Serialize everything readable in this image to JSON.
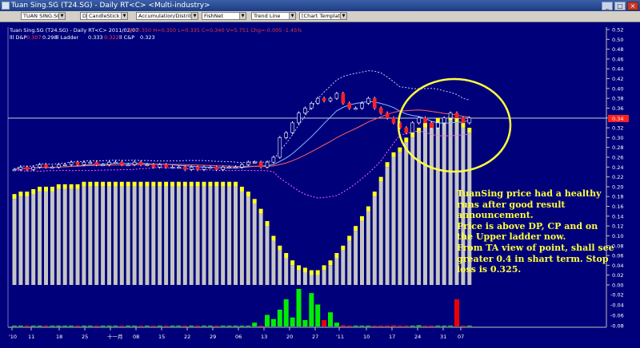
{
  "window": {
    "title": "Tuan Sing.SG (T24.SG) - Daily RT<C> <Multi-industry>",
    "buttons": [
      "_",
      "□",
      "×"
    ]
  },
  "toolbar": {
    "symbol": "TUAN SING.SG",
    "period": "Daily",
    "chart_style": "CandleStick",
    "indicator1": "Accumulation/Distribution",
    "indicator2": "FishNet",
    "indicator3": "Trend Line",
    "template": "[Chart Template]"
  },
  "header": {
    "line1": "Tuan Sing.SG (T24.SG) - Daily RT<C> 2011/02/07",
    "quote": "O=0.350  H=0.350  L=0.335  C=0.340  V=5,751  Chg=-0.005  -1.45%",
    "ind_label1": "lll D&P",
    "ind_val1a": "0.307",
    "ind_val1b": "0.298",
    "ind_label2": "ll Ladder",
    "ind_val2a": "0.333",
    "ind_val2b": "0.322",
    "ind_label3": "ll C&P",
    "ind_val3": "0.323"
  },
  "current_price_label": "0.34",
  "annotation": [
    "TuanSing price had a healthy",
    "runs after good result",
    "announcement.",
    "Price is above DP, CP and on",
    "the Upper ladder now.",
    "From TA view of point, shall see",
    "greater 0.4 in shart term. Stop",
    "loss is 0.325."
  ],
  "colors": {
    "background": "#00007a",
    "annotation": "#ffff3c",
    "highlight_circle": "#ffff3c",
    "ladder_upper": "#ffff22",
    "ladder_lower": "#c0c0c0",
    "volume_up": "#00ee00",
    "volume_down": "#ee0000"
  },
  "chart_data": {
    "type": "candlestick",
    "x_ticks": [
      "'10",
      "11",
      "18",
      "25",
      "十一月",
      "08",
      "15",
      "22",
      "29",
      "06",
      "13",
      "20",
      "27",
      "'11",
      "10",
      "17",
      "24",
      "31",
      "07"
    ],
    "y_ticks_price": [
      "0.52",
      "0.50",
      "0.48",
      "0.46",
      "0.44",
      "0.42",
      "0.40",
      "0.38",
      "0.36",
      "0.34",
      "0.32",
      "0.30",
      "0.28",
      "0.26",
      "0.24",
      "0.22",
      "0.20",
      "0.18",
      "0.16",
      "0.14",
      "0.12",
      "0.10",
      "0.08",
      "0.06",
      "0.04",
      "0.02",
      "0.00"
    ],
    "y_ticks_indicator": [
      "-0.02",
      "-0.04",
      "-0.06",
      "-0.08"
    ],
    "ylim": [
      0.0,
      0.52
    ],
    "closes": [
      0.235,
      0.24,
      0.235,
      0.24,
      0.245,
      0.24,
      0.24,
      0.245,
      0.245,
      0.25,
      0.245,
      0.25,
      0.25,
      0.245,
      0.245,
      0.25,
      0.25,
      0.245,
      0.245,
      0.25,
      0.245,
      0.245,
      0.24,
      0.245,
      0.24,
      0.24,
      0.24,
      0.235,
      0.24,
      0.235,
      0.24,
      0.24,
      0.235,
      0.24,
      0.24,
      0.24,
      0.245,
      0.25,
      0.25,
      0.24,
      0.25,
      0.26,
      0.3,
      0.31,
      0.33,
      0.35,
      0.36,
      0.37,
      0.38,
      0.375,
      0.38,
      0.39,
      0.37,
      0.36,
      0.36,
      0.37,
      0.38,
      0.36,
      0.35,
      0.34,
      0.33,
      0.32,
      0.31,
      0.33,
      0.34,
      0.33,
      0.32,
      0.33,
      0.34,
      0.35,
      0.34,
      0.33,
      0.34
    ],
    "ladder_upper": [
      0.185,
      0.19,
      0.19,
      0.195,
      0.2,
      0.2,
      0.2,
      0.205,
      0.205,
      0.205,
      0.205,
      0.21,
      0.21,
      0.21,
      0.21,
      0.21,
      0.21,
      0.21,
      0.21,
      0.21,
      0.21,
      0.21,
      0.21,
      0.21,
      0.21,
      0.21,
      0.21,
      0.21,
      0.21,
      0.21,
      0.21,
      0.21,
      0.21,
      0.21,
      0.21,
      0.21,
      0.2,
      0.19,
      0.175,
      0.155,
      0.13,
      0.1,
      0.08,
      0.065,
      0.05,
      0.04,
      0.035,
      0.03,
      0.03,
      0.04,
      0.05,
      0.065,
      0.08,
      0.1,
      0.12,
      0.14,
      0.16,
      0.19,
      0.22,
      0.25,
      0.27,
      0.28,
      0.3,
      0.31,
      0.32,
      0.33,
      0.33,
      0.34,
      0.34,
      0.345,
      0.34,
      0.33,
      0.32
    ],
    "volumes": [
      -0.075,
      -0.078,
      -0.072,
      -0.08,
      -0.076,
      -0.082,
      -0.078,
      -0.08,
      -0.085,
      -0.082,
      -0.083,
      -0.085,
      -0.083,
      -0.082,
      -0.084,
      -0.086,
      -0.084,
      -0.085,
      -0.083,
      -0.085,
      -0.086,
      -0.085,
      -0.084,
      -0.086,
      -0.083,
      -0.085,
      -0.084,
      -0.085,
      -0.086,
      -0.085,
      -0.084,
      -0.086,
      -0.085,
      -0.08,
      -0.074,
      -0.079,
      -0.072,
      -0.075,
      -0.065,
      -0.072,
      -0.05,
      -0.058,
      -0.04,
      -0.02,
      -0.055,
      0.0,
      -0.06,
      -0.008,
      -0.03,
      -0.06,
      -0.045,
      -0.065,
      -0.07,
      -0.072,
      -0.08,
      -0.074,
      -0.072,
      -0.078,
      -0.08,
      -0.074,
      -0.07,
      -0.075,
      -0.078,
      -0.072,
      -0.07,
      -0.08,
      -0.076,
      -0.078,
      -0.08,
      -0.08,
      -0.02,
      -0.08,
      -0.075
    ]
  }
}
